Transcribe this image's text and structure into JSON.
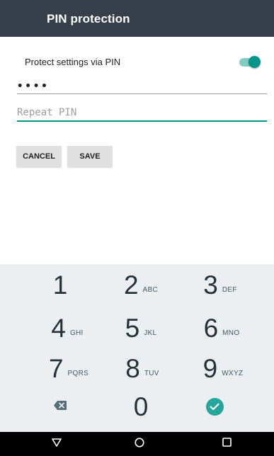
{
  "appbar": {
    "title": "PIN protection"
  },
  "settings": {
    "protect_label": "Protect settings via PIN",
    "protect_enabled": true
  },
  "pin_field": {
    "value": "••••"
  },
  "repeat_field": {
    "placeholder": "Repeat PIN",
    "value": ""
  },
  "buttons": {
    "cancel": "CANCEL",
    "save": "SAVE"
  },
  "keyboard": {
    "keys": [
      {
        "num": "1",
        "letters": ""
      },
      {
        "num": "2",
        "letters": "ABC"
      },
      {
        "num": "3",
        "letters": "DEF"
      },
      {
        "num": "4",
        "letters": "GHI"
      },
      {
        "num": "5",
        "letters": "JKL"
      },
      {
        "num": "6",
        "letters": "MNO"
      },
      {
        "num": "7",
        "letters": "PQRS"
      },
      {
        "num": "8",
        "letters": "TUV"
      },
      {
        "num": "9",
        "letters": "WXYZ"
      },
      {
        "num": "0",
        "letters": ""
      }
    ],
    "backspace_icon": "backspace-icon",
    "done_icon": "check-icon"
  },
  "navbar": {
    "back_icon": "back-triangle-icon",
    "home_icon": "home-circle-icon",
    "recents_icon": "recents-square-icon"
  },
  "colors": {
    "appbar": "#37404a",
    "accent": "#009688",
    "keyboard_bg": "#eceff1",
    "navbar": "#000000"
  }
}
